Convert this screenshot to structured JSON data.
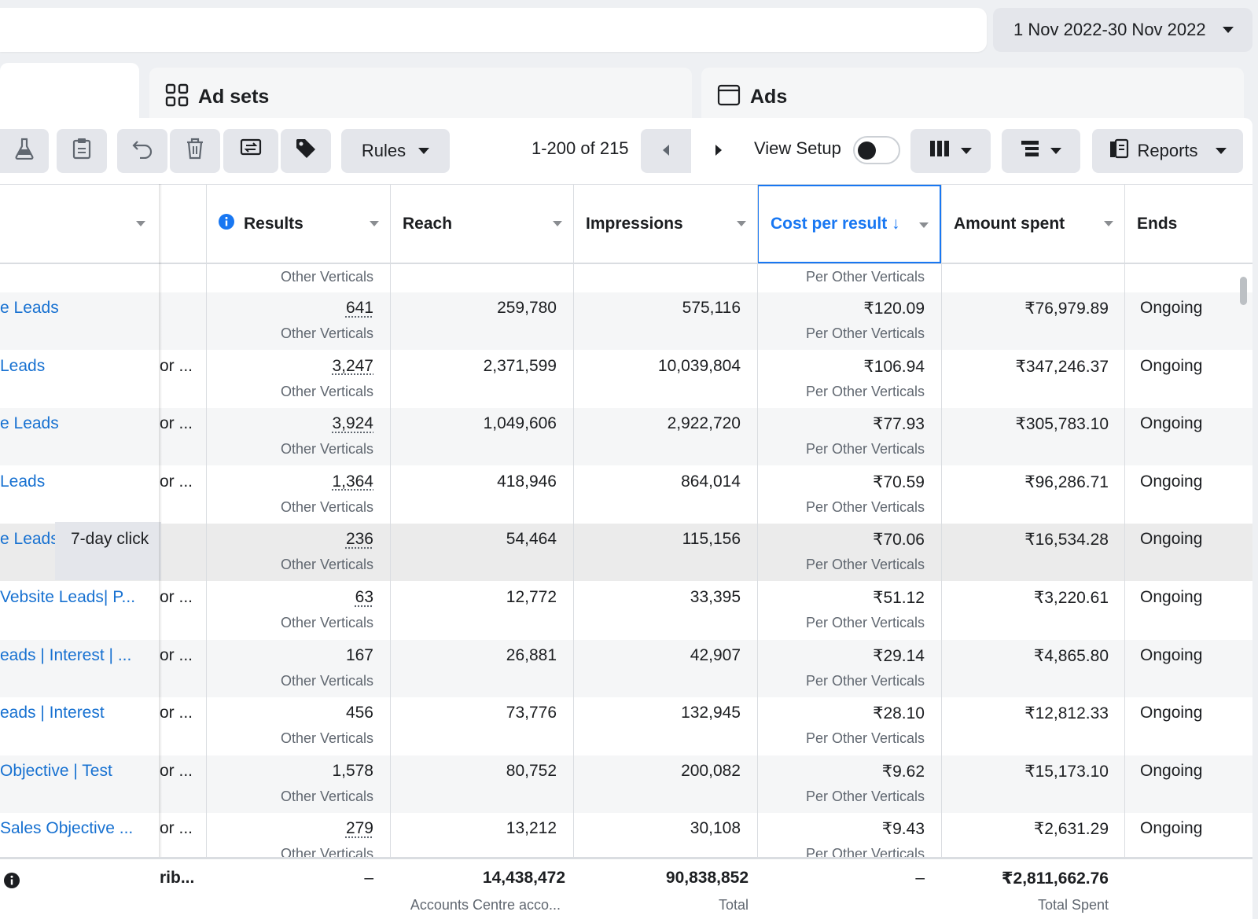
{
  "date_range": {
    "label": "1 Nov 2022-30 Nov 2022"
  },
  "tabs": {
    "ad_sets": "Ad sets",
    "ads": "Ads"
  },
  "toolbar": {
    "rules_label": "Rules",
    "pagination": "1-200 of 215",
    "view_setup_label": "View Setup",
    "view_setup_on": false,
    "reports_label": "Reports"
  },
  "columns": {
    "results": "Results",
    "reach": "Reach",
    "impressions": "Impressions",
    "cost_per_result": "Cost per result ↓",
    "amount_spent": "Amount spent",
    "ends": "Ends"
  },
  "top_partial": {
    "results_sub": "Other Verticals",
    "cost_sub": "Per Other Verticals"
  },
  "rows": [
    {
      "name": "e Leads",
      "attr": "",
      "results": "641",
      "results_sub": "Other Verticals",
      "reach": "259,780",
      "impressions": "575,116",
      "cost": "₹120.09",
      "cost_sub": "Per Other Verticals",
      "spent": "₹76,979.89",
      "ends": "Ongoing"
    },
    {
      "name": "Leads",
      "attr": "or ...",
      "results": "3,247",
      "results_sub": "Other Verticals",
      "reach": "2,371,599",
      "impressions": "10,039,804",
      "cost": "₹106.94",
      "cost_sub": "Per Other Verticals",
      "spent": "₹347,246.37",
      "ends": "Ongoing"
    },
    {
      "name": "e Leads",
      "attr": "or ...",
      "results": "3,924",
      "results_sub": "Other Verticals",
      "reach": "1,049,606",
      "impressions": "2,922,720",
      "cost": "₹77.93",
      "cost_sub": "Per Other Verticals",
      "spent": "₹305,783.10",
      "ends": "Ongoing"
    },
    {
      "name": "Leads",
      "attr": "or ...",
      "results": "1,364",
      "results_sub": "Other Verticals",
      "reach": "418,946",
      "impressions": "864,014",
      "cost": "₹70.59",
      "cost_sub": "Per Other Verticals",
      "spent": "₹96,286.71",
      "ends": "Ongoing"
    },
    {
      "name": "e Leads",
      "attr": "",
      "results": "236",
      "results_sub": "Other Verticals",
      "reach": "54,464",
      "impressions": "115,156",
      "cost": "₹70.06",
      "cost_sub": "Per Other Verticals",
      "spent": "₹16,534.28",
      "ends": "Ongoing"
    },
    {
      "name": "Vebsite Leads| P...",
      "attr": "or ...",
      "results": "63",
      "results_sub": "Other Verticals",
      "reach": "12,772",
      "impressions": "33,395",
      "cost": "₹51.12",
      "cost_sub": "Per Other Verticals",
      "spent": "₹3,220.61",
      "ends": "Ongoing"
    },
    {
      "name": "eads | Interest | ...",
      "attr": "or ...",
      "results": "167",
      "results_sub": "Other Verticals",
      "reach": "26,881",
      "impressions": "42,907",
      "cost": "₹29.14",
      "cost_sub": "Per Other Verticals",
      "spent": "₹4,865.80",
      "ends": "Ongoing"
    },
    {
      "name": "eads | Interest",
      "attr": "or ...",
      "results": "456",
      "results_sub": "Other Verticals",
      "reach": "73,776",
      "impressions": "132,945",
      "cost": "₹28.10",
      "cost_sub": "Per Other Verticals",
      "spent": "₹12,812.33",
      "ends": "Ongoing"
    },
    {
      "name": "Objective | Test",
      "attr": "or ...",
      "results": "1,578",
      "results_sub": "Other Verticals",
      "reach": "80,752",
      "impressions": "200,082",
      "cost": "₹9.62",
      "cost_sub": "Per Other Verticals",
      "spent": "₹15,173.10",
      "ends": "Ongoing"
    },
    {
      "name": " Sales Objective ...",
      "attr": "or ...",
      "results": "279",
      "results_sub": "Other Verticals",
      "reach": "13,212",
      "impressions": "30,108",
      "cost": "₹9.43",
      "cost_sub": "Per Other Verticals",
      "spent": "₹2,631.29",
      "ends": "Ongoing"
    }
  ],
  "tooltip": "7-day click",
  "footer": {
    "attr": "rib...",
    "results": "–",
    "reach": "14,438,472",
    "reach_sub": "Accounts Centre acco...",
    "impressions": "90,838,852",
    "impressions_sub": "Total",
    "cost": "–",
    "spent": "₹2,811,662.76",
    "spent_sub": "Total Spent"
  }
}
